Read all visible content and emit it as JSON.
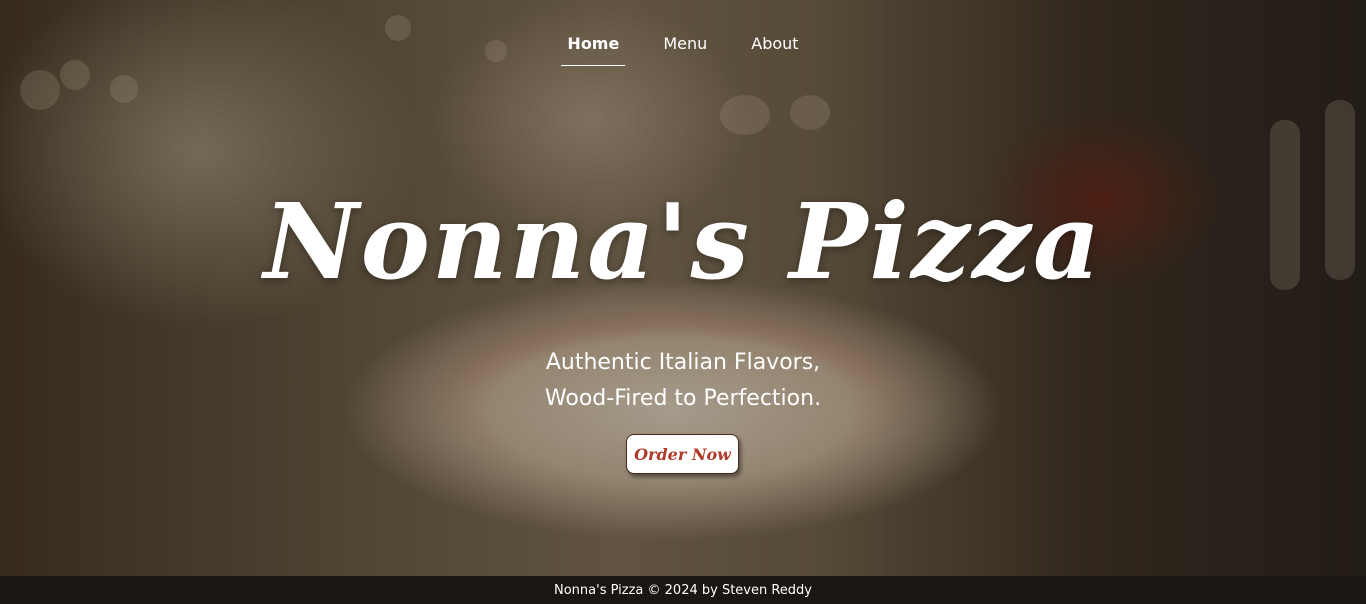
{
  "nav": {
    "items": [
      {
        "label": "Home",
        "active": true
      },
      {
        "label": "Menu",
        "active": false
      },
      {
        "label": "About",
        "active": false
      }
    ]
  },
  "hero": {
    "title": "Nonna's Pizza",
    "subtitle_line1": "Authentic Italian Flavors,",
    "subtitle_line2": "Wood-Fired to Perfection.",
    "cta_label": "Order Now"
  },
  "footer": {
    "text": "Nonna's Pizza © 2024 by Steven Reddy"
  },
  "colors": {
    "cta_text": "#b03a28",
    "footer_bg": "#1a1612",
    "text": "#ffffff"
  }
}
